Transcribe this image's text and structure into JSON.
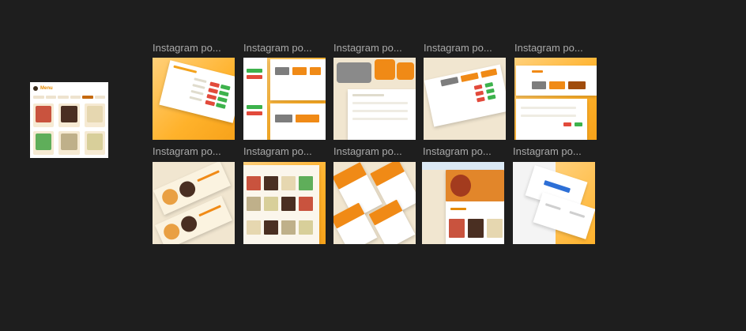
{
  "menu_frame": {
    "title": "Menu"
  },
  "frames": [
    {
      "label": "Instagram po..."
    },
    {
      "label": "Instagram po..."
    },
    {
      "label": "Instagram po..."
    },
    {
      "label": "Instagram po..."
    },
    {
      "label": "Instagram po..."
    },
    {
      "label": "Instagram po..."
    },
    {
      "label": "Instagram po..."
    },
    {
      "label": "Instagram po..."
    },
    {
      "label": "Instagram po..."
    },
    {
      "label": "Instagram po..."
    }
  ],
  "colors": {
    "canvas_bg": "#1e1e1e",
    "label": "#a9a9a9",
    "orange": "#ffb22b",
    "cream": "#f1e6d0"
  }
}
